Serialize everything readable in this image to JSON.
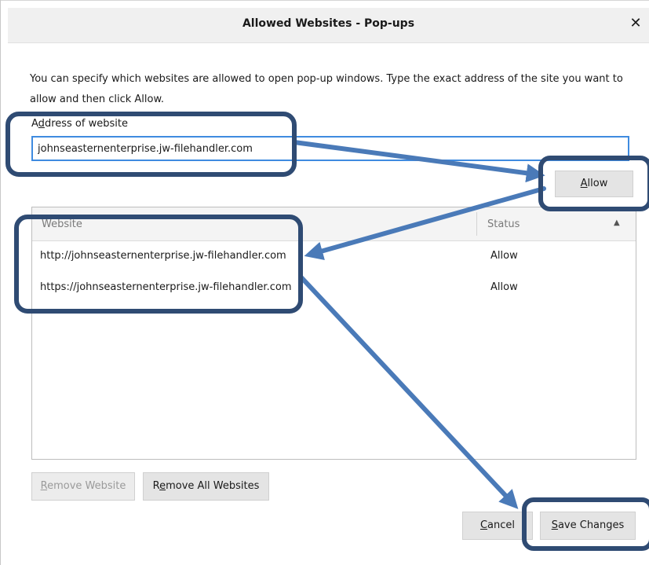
{
  "dialog": {
    "title": "Allowed Websites - Pop-ups",
    "close_glyph": "✕",
    "description": "You can specify which websites are allowed to open pop-up windows. Type the exact address of the site you want to allow and then click Allow."
  },
  "address": {
    "label_prefix": "A",
    "label_accel": "d",
    "label_suffix": "dress of website",
    "value": "johnseasternenterprise.jw-filehandler.com"
  },
  "allow_button": {
    "accel": "A",
    "rest": "llow"
  },
  "table": {
    "headers": {
      "website": "Website",
      "status": "Status"
    },
    "sort_icon": "▲",
    "rows": [
      {
        "website": "http://johnseasternenterprise.jw-filehandler.com",
        "status": "Allow"
      },
      {
        "website": "https://johnseasternenterprise.jw-filehandler.com",
        "status": "Allow"
      }
    ]
  },
  "remove_button": {
    "accel": "R",
    "rest": "emove Website"
  },
  "remove_all_button": {
    "pre": "R",
    "accel": "e",
    "rest": "move All Websites"
  },
  "cancel_button": {
    "accel": "C",
    "rest": "ancel"
  },
  "save_button": {
    "accel": "S",
    "rest": "ave Changes"
  },
  "colors": {
    "annotation": "#2f4b73",
    "arrow": "#4a7ab8",
    "input_focus": "#3f8be0"
  }
}
